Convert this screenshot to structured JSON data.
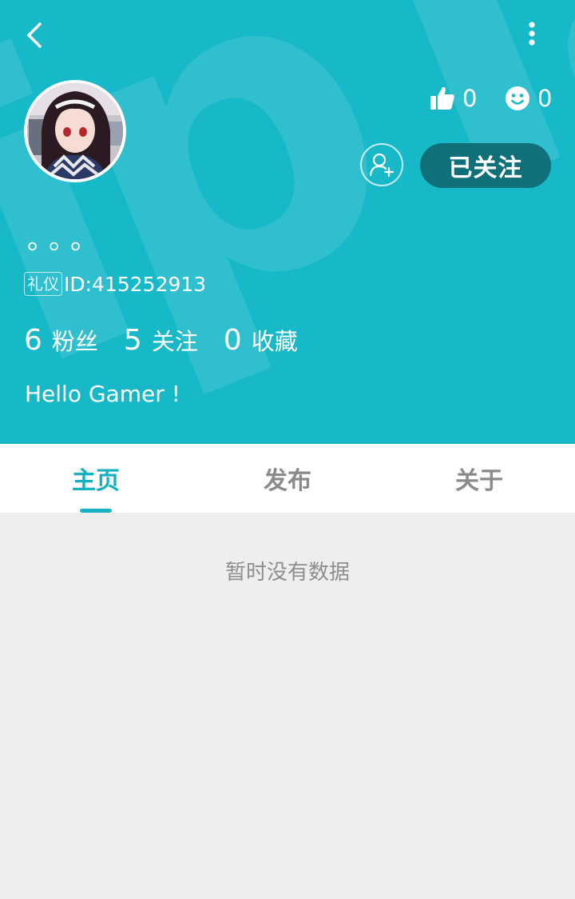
{
  "header": {
    "background_color": "#17b8c8",
    "back_icon": "chevron-left-icon",
    "more_icon": "more-vertical-icon"
  },
  "profile": {
    "nickname": "。。。",
    "badge": "礼仪",
    "id_text": "ID:415252913",
    "bio": "Hello Gamer !",
    "likes": "0",
    "smiles": "0",
    "follow_label": "已关注",
    "add_friend_icon": "user-plus-icon"
  },
  "counts": [
    {
      "value": "6",
      "label": "粉丝"
    },
    {
      "value": "5",
      "label": "关注"
    },
    {
      "value": "0",
      "label": "收藏"
    }
  ],
  "tabs": [
    {
      "label": "主页",
      "active": true
    },
    {
      "label": "发布",
      "active": false
    },
    {
      "label": "关于",
      "active": false
    }
  ],
  "accent_color": "#17b0c0",
  "empty_message": "暂时没有数据"
}
